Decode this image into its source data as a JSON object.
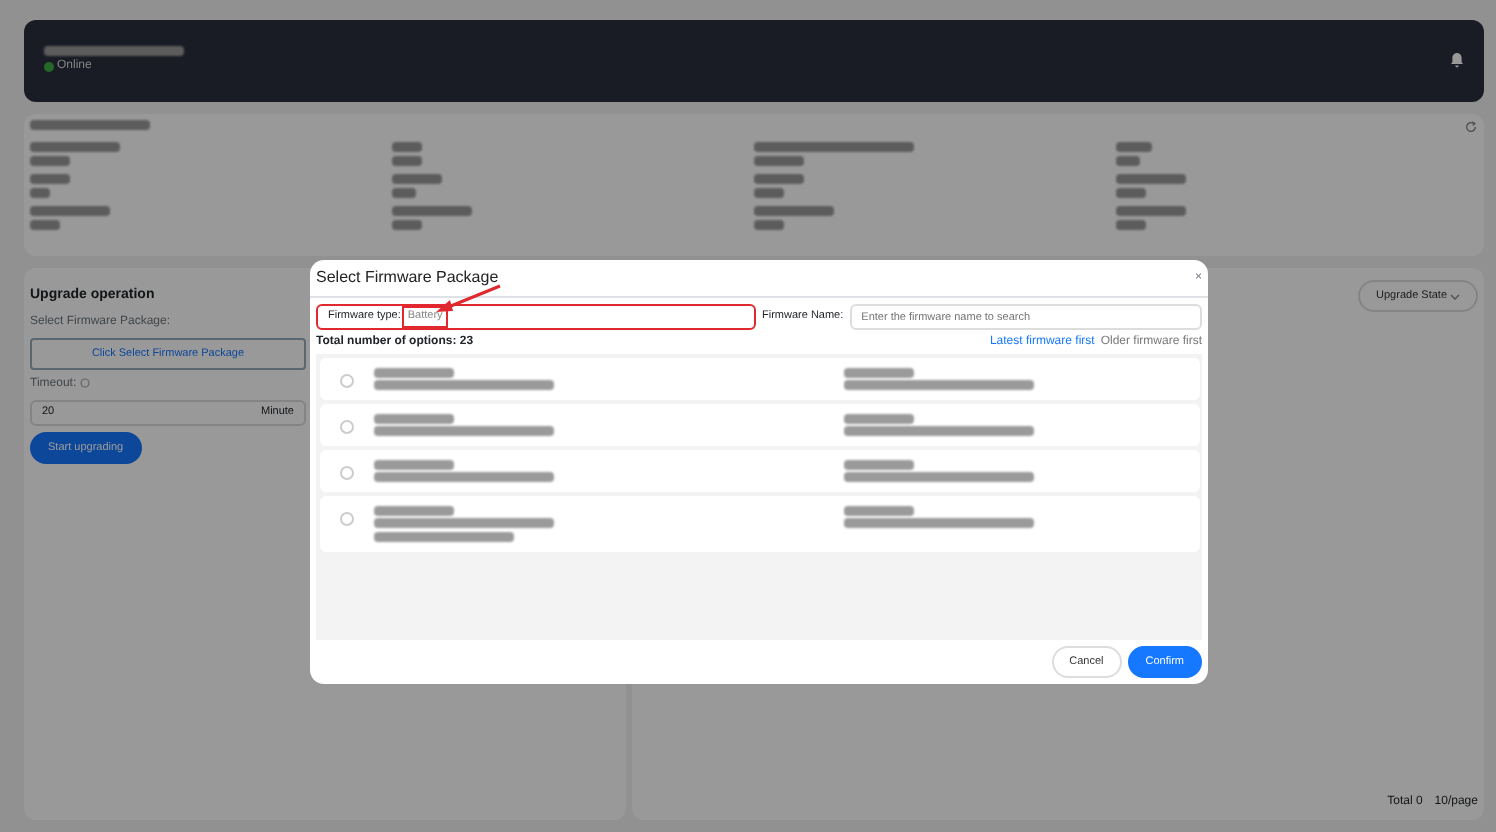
{
  "header": {
    "status": "Online",
    "online": true
  },
  "upgrade_operation": {
    "title": "Upgrade operation",
    "package_label": "Select Firmware Package:",
    "package_button": "Click Select Firmware Package",
    "timeout_label": "Timeout:",
    "timeout_value": "20",
    "timeout_unit": "Minute",
    "start_button": "Start upgrading"
  },
  "upgrade_state": {
    "filter": "Upgrade State",
    "total": "Total 0",
    "page_size": "10/page"
  },
  "modal": {
    "title": "Select Firmware Package",
    "close": "×",
    "firmware_type_label": "Firmware type:",
    "firmware_type": "Battery",
    "firmware_type_highlighted": true,
    "firmware_name_label": "Firmware Name:",
    "firmware_name": {
      "placeholder": "Enter the firmware name to search"
    },
    "total": "Total number of options: 23",
    "sort": [
      {
        "label": "Latest firmware first",
        "selected": true
      },
      {
        "label": "Older firmware first",
        "selected": false
      }
    ],
    "options": [
      {
        "selected": false,
        "kind": "short"
      },
      {
        "selected": false,
        "kind": "short"
      },
      {
        "selected": false,
        "kind": "short"
      },
      {
        "selected": false,
        "kind": "tall"
      }
    ],
    "buttons": [
      {
        "label": "Cancel",
        "kind": "secondary"
      },
      {
        "label": "Confirm",
        "kind": "primary"
      }
    ]
  }
}
